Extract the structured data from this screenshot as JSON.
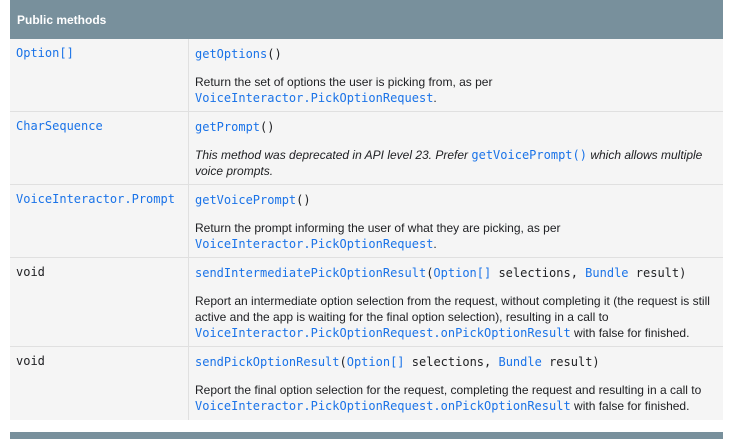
{
  "header": {
    "title": "Public methods"
  },
  "rows": [
    {
      "type": "Option[]",
      "method": "getOptions",
      "params_text": "()",
      "desc_pre": "Return the set of options the user is picking from, as per",
      "desc_link": "VoiceInteractor.PickOptionRequest",
      "desc_post": "."
    },
    {
      "type": "CharSequence",
      "method": "getPrompt",
      "params_text": "()",
      "desc_pre": "This method was deprecated in API level 23. Prefer",
      "desc_link": "getVoicePrompt()",
      "desc_post": "which allows multiple voice prompts."
    },
    {
      "type": "VoiceInteractor.Prompt",
      "method": "getVoicePrompt",
      "params_text": "()",
      "desc_pre": "Return the prompt informing the user of what they are picking, as per",
      "desc_link": "VoiceInteractor.PickOptionRequest",
      "desc_post": "."
    },
    {
      "type": "void",
      "method": "sendIntermediatePickOptionResult",
      "param1_type": "Option[]",
      "param1_name": "selections,",
      "param2_type": "Bundle",
      "param2_name": "result)",
      "desc_pre": "Report an intermediate option selection from the request, without completing it (the request is still active and the app is waiting for the final option selection), resulting in a call to",
      "desc_link": "VoiceInteractor.PickOptionRequest.onPickOptionResult",
      "desc_post": "with false for finished."
    },
    {
      "type": "void",
      "method": "sendPickOptionResult",
      "param1_type": "Option[]",
      "param1_name": "selections,",
      "param2_type": "Bundle",
      "param2_name": "result)",
      "desc_pre": "Report the final option selection for the request, completing the request and resulting in a call to",
      "desc_link": "VoiceInteractor.PickOptionRequest.onPickOptionResult",
      "desc_post": "with false for finished."
    }
  ],
  "colors": {
    "header_bg": "#78909c",
    "row_bg": "#f5f5f5",
    "link": "#1a73e8",
    "text": "#202124"
  }
}
